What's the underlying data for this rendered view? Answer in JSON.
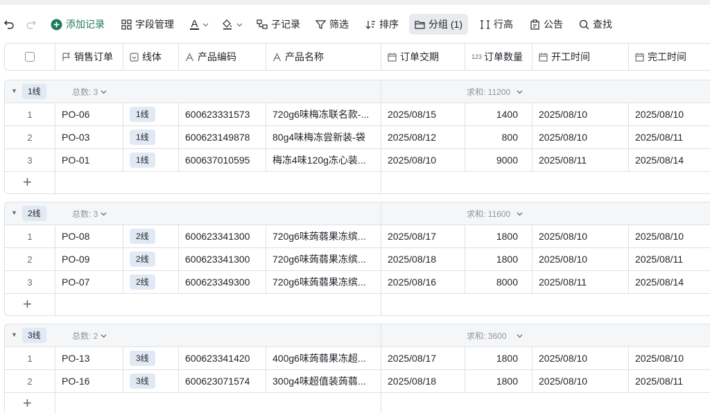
{
  "toolbar": {
    "add_record": "添加记录",
    "field_manage": "字段管理",
    "font_letter": "A",
    "sub_record": "子记录",
    "filter": "筛选",
    "sort": "排序",
    "group": "分组 (1)",
    "row_height": "行高",
    "notice": "公告",
    "search": "查找"
  },
  "columns": [
    {
      "label": "销售订单",
      "icon": "flag-icon"
    },
    {
      "label": "线体",
      "icon": "single-select-icon"
    },
    {
      "label": "产品编码",
      "icon": "text-field-icon"
    },
    {
      "label": "产品名称",
      "icon": "text-field-icon"
    },
    {
      "label": "订单交期",
      "icon": "calendar-icon"
    },
    {
      "label": "订单数量",
      "icon": "number-field-icon"
    },
    {
      "label": "开工时间",
      "icon": "calendar-icon"
    },
    {
      "label": "完工时间",
      "icon": "calendar-icon"
    }
  ],
  "number_icon_text": "123",
  "groups": [
    {
      "name": "1线",
      "count_label": "总数: 3",
      "sum_label": "求和: 11200",
      "rows": [
        {
          "idx": "1",
          "order": "PO-06",
          "line": "1线",
          "code": "600623331573",
          "name": "720g6味梅冻联名款-...",
          "due": "2025/08/15",
          "qty": "1400",
          "start": "2025/08/10",
          "end": "2025/08/10"
        },
        {
          "idx": "2",
          "order": "PO-03",
          "line": "1线",
          "code": "600623149878",
          "name": "80g4味梅冻尝新装-袋",
          "due": "2025/08/12",
          "qty": "800",
          "start": "2025/08/10",
          "end": "2025/08/11"
        },
        {
          "idx": "3",
          "order": "PO-01",
          "line": "1线",
          "code": "600637010595",
          "name": "梅冻4味120g冻心装...",
          "due": "2025/08/10",
          "qty": "9000",
          "start": "2025/08/11",
          "end": "2025/08/14"
        }
      ]
    },
    {
      "name": "2线",
      "count_label": "总数: 3",
      "sum_label": "求和: 11600",
      "rows": [
        {
          "idx": "1",
          "order": "PO-08",
          "line": "2线",
          "code": "600623341300",
          "name": "720g6味蒟蒻果冻缤...",
          "due": "2025/08/17",
          "qty": "1800",
          "start": "2025/08/10",
          "end": "2025/08/10"
        },
        {
          "idx": "2",
          "order": "PO-09",
          "line": "2线",
          "code": "600623341300",
          "name": "720g6味蒟蒻果冻缤...",
          "due": "2025/08/18",
          "qty": "1800",
          "start": "2025/08/10",
          "end": "2025/08/11"
        },
        {
          "idx": "3",
          "order": "PO-07",
          "line": "2线",
          "code": "600623349300",
          "name": "720g6味蒟蒻果冻缤...",
          "due": "2025/08/16",
          "qty": "8000",
          "start": "2025/08/11",
          "end": "2025/08/14"
        }
      ]
    },
    {
      "name": "3线",
      "count_label": "总数: 2",
      "sum_label": "求和: 3600",
      "rows": [
        {
          "idx": "1",
          "order": "PO-13",
          "line": "3线",
          "code": "600623341420",
          "name": "400g6味蒟蒻果冻超...",
          "due": "2025/08/17",
          "qty": "1800",
          "start": "2025/08/10",
          "end": "2025/08/10"
        },
        {
          "idx": "2",
          "order": "PO-16",
          "line": "3线",
          "code": "600623071574",
          "name": "300g4味超值装蒟蒻...",
          "due": "2025/08/18",
          "qty": "1800",
          "start": "2025/08/10",
          "end": "2025/08/11"
        }
      ]
    }
  ],
  "add_symbol": "+",
  "colors": {
    "accent_green": "#1f7a5a",
    "tag_bg": "#e1e9f5",
    "border": "#dee0e3"
  }
}
